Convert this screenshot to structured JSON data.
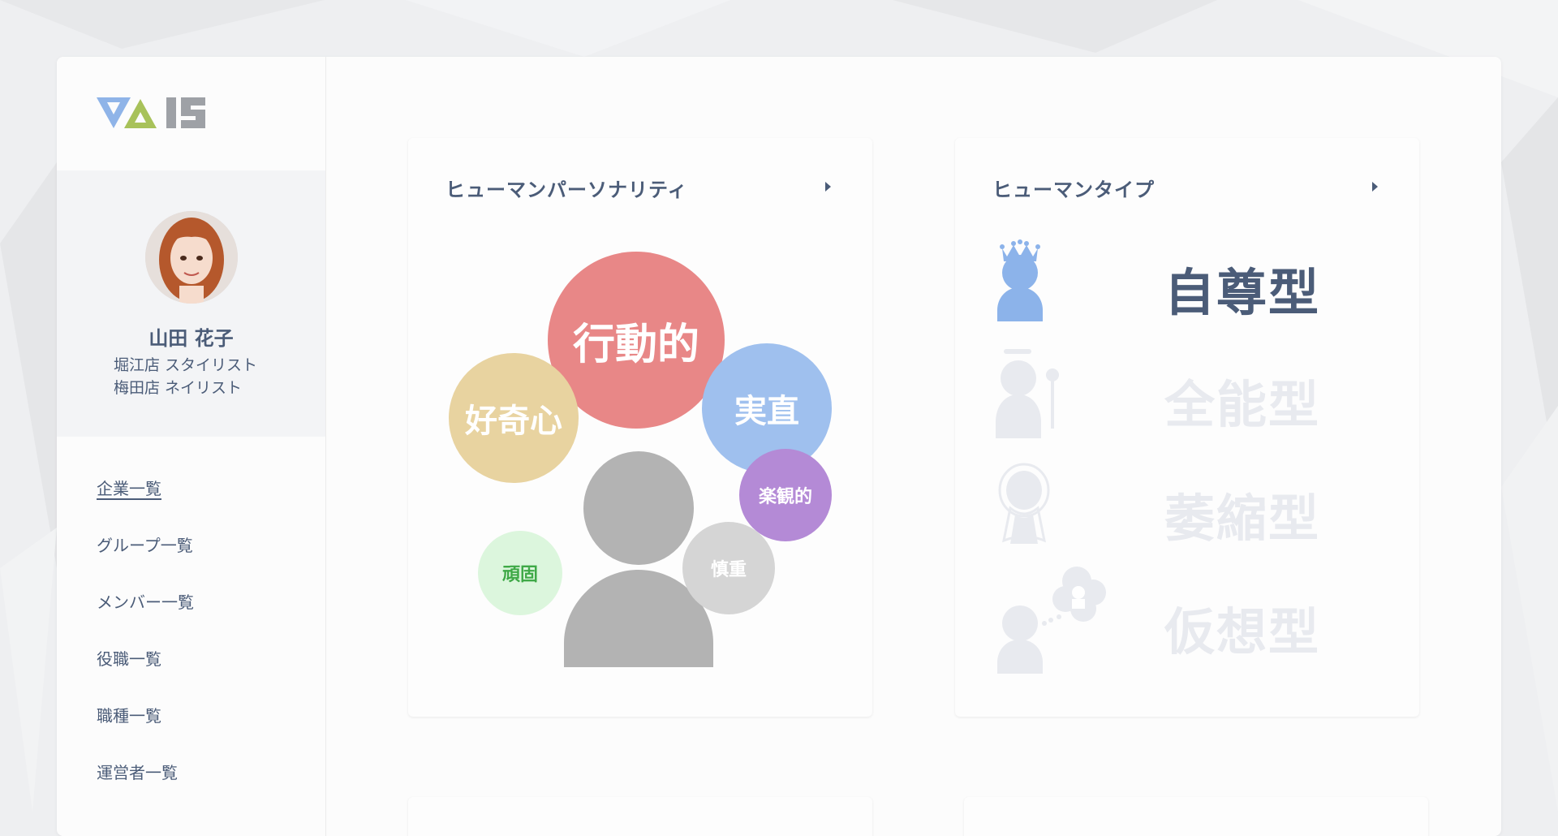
{
  "brand": {
    "logo_alt": "VAIS",
    "colors": {
      "blue": "#8fb4e8",
      "green": "#a8c25a",
      "gray": "#9ea1a6"
    }
  },
  "user": {
    "name": "山田 花子",
    "roles": [
      "堀江店 スタイリスト",
      "梅田店 ネイリスト"
    ]
  },
  "nav": {
    "items": [
      {
        "label": "企業一覧",
        "active": true
      },
      {
        "label": "グループ一覧",
        "active": false
      },
      {
        "label": "メンバー一覧",
        "active": false
      },
      {
        "label": "役職一覧",
        "active": false
      },
      {
        "label": "職種一覧",
        "active": false
      },
      {
        "label": "運営者一覧",
        "active": false
      }
    ]
  },
  "personality_card": {
    "title": "ヒューマンパーソナリティ",
    "traits": [
      {
        "label": "行動的",
        "color": "#e88787"
      },
      {
        "label": "好奇心",
        "color": "#e8d3a0"
      },
      {
        "label": "実直",
        "color": "#9fc0ee"
      },
      {
        "label": "楽観的",
        "color": "#b48ad6"
      },
      {
        "label": "慎重",
        "color": "#d5d5d5"
      },
      {
        "label": "頑固",
        "color": "#dcf6dd",
        "text_color": "#3fa947"
      }
    ],
    "figure_color": "#b3b3b3"
  },
  "type_card": {
    "title": "ヒューマンタイプ",
    "types": [
      {
        "label": "自尊型",
        "active": true,
        "icon": "crown-person-icon"
      },
      {
        "label": "全能型",
        "active": false,
        "icon": "halo-staff-person-icon"
      },
      {
        "label": "萎縮型",
        "active": false,
        "icon": "shrinking-person-icon"
      },
      {
        "label": "仮想型",
        "active": false,
        "icon": "dreaming-person-icon"
      }
    ],
    "active_color": "#4b5c78",
    "inactive_color": "#e8eaef",
    "icon_active_color": "#8cb3ea"
  }
}
